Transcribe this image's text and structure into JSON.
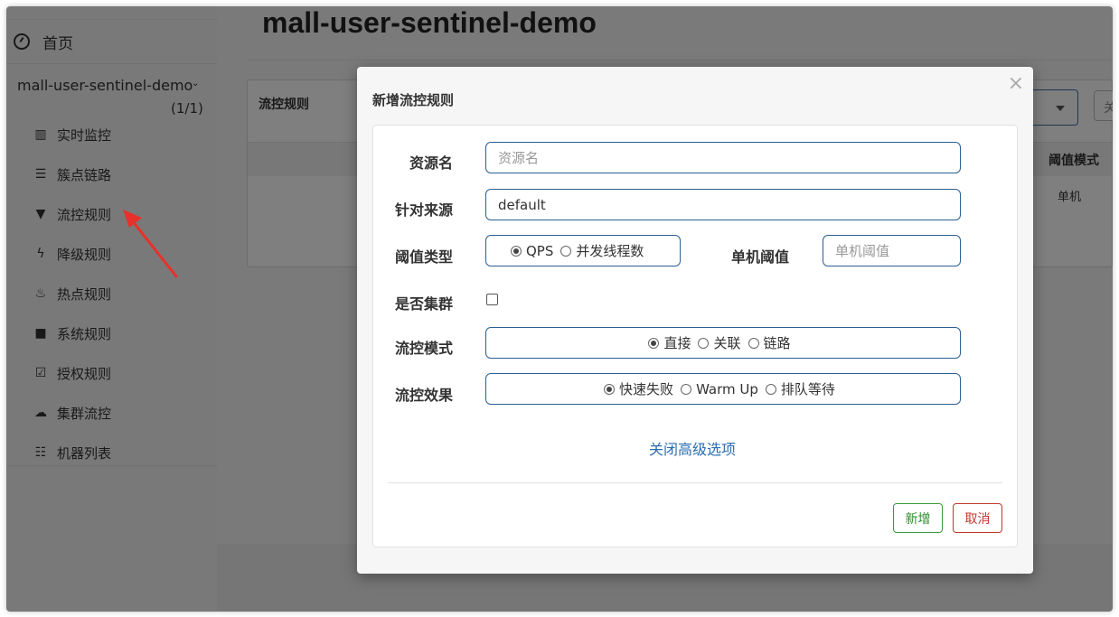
{
  "sidebar": {
    "home_label": "首页",
    "app_name": "mall-user-sentinel-demo",
    "app_count": "(1/1)",
    "items": [
      {
        "label": "实时监控",
        "icon": "bar-chart-icon",
        "glyph": "▥"
      },
      {
        "label": "簇点链路",
        "icon": "list-alt-icon",
        "glyph": "☰"
      },
      {
        "label": "流控规则",
        "icon": "filter-icon",
        "glyph": "▼"
      },
      {
        "label": "降级规则",
        "icon": "flash-icon",
        "glyph": "ϟ"
      },
      {
        "label": "热点规则",
        "icon": "fire-icon",
        "glyph": "♨"
      },
      {
        "label": "系统规则",
        "icon": "lock-icon",
        "glyph": "■"
      },
      {
        "label": "授权规则",
        "icon": "check-icon",
        "glyph": "☑"
      },
      {
        "label": "集群流控",
        "icon": "cloud-icon",
        "glyph": "☁"
      },
      {
        "label": "机器列表",
        "icon": "th-list-icon",
        "glyph": "☷"
      }
    ]
  },
  "main": {
    "title": "mall-user-sentinel-demo",
    "panel_title": "流控规则",
    "column_mode": "阈值模式",
    "cell_mode": "单机",
    "stub_button_text": "关"
  },
  "modal": {
    "title": "新增流控规则",
    "close": "×",
    "resource_label": "资源名",
    "resource_placeholder": "资源名",
    "source_label": "针对来源",
    "source_value": "default",
    "threshold_type_label": "阈值类型",
    "threshold_type_options": [
      "QPS",
      "并发线程数"
    ],
    "threshold_type_selected": "QPS",
    "single_threshold_label": "单机阈值",
    "single_threshold_placeholder": "单机阈值",
    "cluster_label": "是否集群",
    "cluster_checked": false,
    "mode_label": "流控模式",
    "mode_options": [
      "直接",
      "关联",
      "链路"
    ],
    "mode_selected": "直接",
    "effect_label": "流控效果",
    "effect_options": [
      "快速失败",
      "Warm Up",
      "排队等待"
    ],
    "effect_selected": "快速失败",
    "advanced_link": "关闭高级选项",
    "add_button": "新增",
    "cancel_button": "取消"
  },
  "colors": {
    "accent_border": "#2c5f93",
    "link": "#2a6db0",
    "ok": "#2e8b2e",
    "cancel": "#c0392b",
    "annotation_arrow": "#e8302a"
  }
}
